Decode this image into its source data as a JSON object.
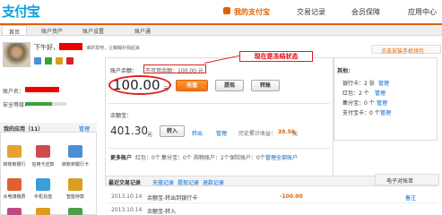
{
  "header": {
    "logo": "支付宝",
    "nav": [
      "我的支付宝",
      "交易记录",
      "会员保障",
      "应用中心"
    ]
  },
  "subnav": [
    "首页",
    "账户资产",
    "账户设置",
    "账户通"
  ],
  "user": {
    "greeting": "下午好，",
    "notice": "谁研发吧，让糊糊补我起来",
    "account_label": "账户名：",
    "security_label": "安全等级："
  },
  "apps": {
    "title": "我的应用（11）",
    "manage": "管理",
    "items": [
      "转账到银行",
      "信用卡还款",
      "转账到银行卡",
      "水电煤缴费",
      "手机充值",
      "智能存款"
    ]
  },
  "balance": {
    "label": "账户余额：",
    "frozen_text": "不可用余额：100.00 元",
    "amount": "100.00",
    "unit": "元",
    "recharge": "充值",
    "withdraw": "提现",
    "transfer": "转账"
  },
  "annotation": "现在是冻结状态",
  "yuebao": {
    "label": "余额宝：",
    "amount": "401.30",
    "unit": "元",
    "transfer_in": "转入",
    "transfer_out": "转出",
    "manage": "管理",
    "history": "历史累计收益：",
    "earnings": "39.56",
    "earnings_unit": "元"
  },
  "more_accounts": {
    "label": "更多账户",
    "items": [
      "红包：0个",
      "集分宝：0个",
      "购物账户：2个",
      "保险账户：0个",
      "管理全部账户"
    ]
  },
  "right_panel": {
    "title": "其他：",
    "items": [
      "银行卡：2 张",
      "红包：2 个",
      "集分宝：0 个",
      "支付宝卡：0 个"
    ],
    "manage": "管理"
  },
  "promo": "点击安装手机钱包",
  "records": {
    "title": "最近交易记录",
    "tabs": [
      "充值记录",
      "提现记录",
      "退款记录"
    ],
    "rows": [
      {
        "date": "2013.10.14",
        "desc": "余额宝-转出到银行卡",
        "amount": "-100.00",
        "status": "备注"
      },
      {
        "date": "2013.10.14",
        "desc": "余额宝-转入",
        "amount": "",
        "status": ""
      }
    ]
  },
  "phone_service": "电子对账单",
  "colors": {
    "accent": "#e06000",
    "brand": "#0aa0e4",
    "red": "#e02020"
  }
}
